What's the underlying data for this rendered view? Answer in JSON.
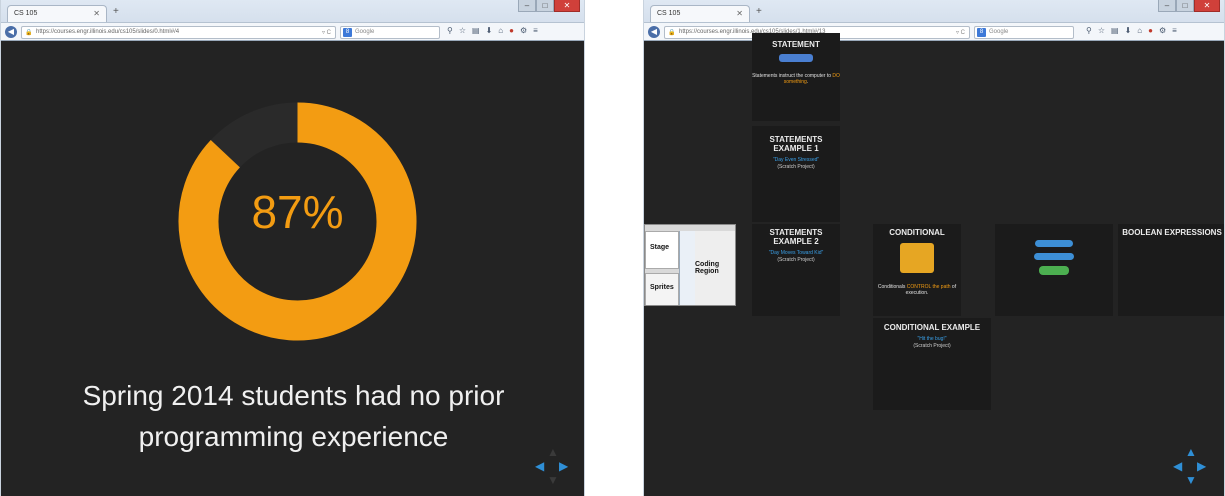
{
  "colors": {
    "accent": "#f39c12",
    "nav_blue": "#2f8fd6",
    "slide_bg": "#232323",
    "link": "#3aa0e8"
  },
  "window1": {
    "tab_title": "CS 105",
    "url": "https://courses.engr.illinois.edu/cs105/slides/0.html#/4",
    "search_placeholder": "Google",
    "slide": {
      "percent_value": 87,
      "percent_label": "87%",
      "caption_line1": "Spring 2014 students had no prior",
      "caption_line2": "programming experience"
    }
  },
  "window2": {
    "tab_title": "CS 105",
    "url": "https://courses.engr.illinois.edu/cs105/slides/1.html#/13",
    "search_placeholder": "Google",
    "cards": {
      "statement": {
        "title": "STATEMENT",
        "text_before": "Statements instruct the computer to ",
        "text_highlight": "DO something",
        "text_after": "."
      },
      "statements_example_1": {
        "title": "STATEMENTS EXAMPLE 1",
        "link": "\"Day Even Stressed\"",
        "sub": "(Scratch Project)"
      },
      "statements_example_2": {
        "title": "STATEMENTS EXAMPLE 2",
        "link": "\"Day Moves Toward Kid\"",
        "sub": "(Scratch Project)"
      },
      "conditional": {
        "title": "CONDITIONAL",
        "text_before": "Conditionals ",
        "text_highlight": "CONTROL the path",
        "text_after": " of execution."
      },
      "boolean_expressions": {
        "title": "BOOLEAN EXPRESSIONS"
      },
      "conditional_example": {
        "title": "CONDITIONAL EXAMPLE",
        "link": "\"Hit the bug!\"",
        "sub": "(Scratch Project)"
      }
    },
    "thumbnail": {
      "stage": "Stage",
      "sprites": "Sprites",
      "coding_region": "Coding Region"
    }
  }
}
